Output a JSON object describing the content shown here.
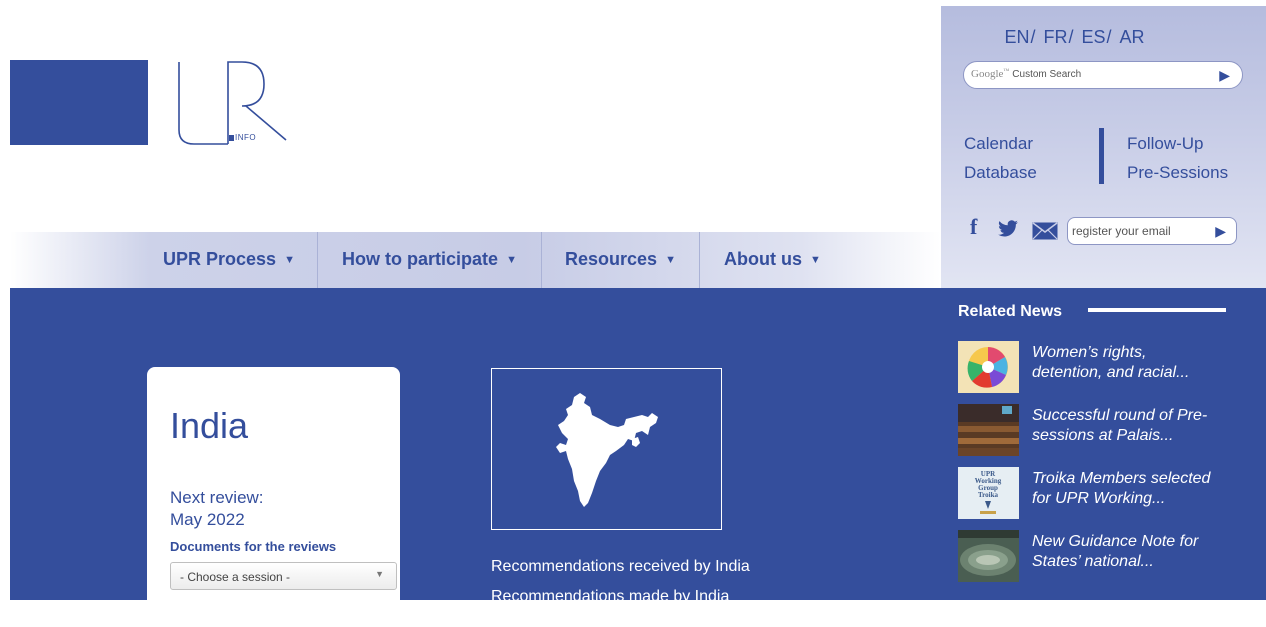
{
  "languages": [
    "EN",
    "FR",
    "ES",
    "AR"
  ],
  "search": {
    "brand": "Google",
    "tm": "™",
    "label": "Custom Search"
  },
  "quick_links": {
    "calendar": "Calendar",
    "database": "Database",
    "follow_up": "Follow-Up",
    "pre_sessions": "Pre-Sessions"
  },
  "newsletter": {
    "placeholder": "register your email"
  },
  "logo": {
    "info": "INFO"
  },
  "nav": [
    {
      "label": "UPR Process"
    },
    {
      "label": "How to participate"
    },
    {
      "label": "Resources"
    },
    {
      "label": "About us"
    }
  ],
  "country_card": {
    "country": "India",
    "next_review_label": "Next review:",
    "next_review_date": "May 2022",
    "documents_title": "Documents for the reviews",
    "session_select": "- Choose a session -"
  },
  "recommendations": {
    "received": "Recommendations received by India",
    "made": "Recommendations made by India"
  },
  "related_news": {
    "title": "Related News",
    "items": [
      {
        "line1": "Women’s rights,",
        "line2": "detention, and racial..."
      },
      {
        "line1": "Successful round of Pre-",
        "line2": "sessions at Palais..."
      },
      {
        "line1": "Troika Members selected",
        "line2": "for UPR Working...",
        "thumb_text": [
          "UPR",
          "Working",
          "Group",
          "Troika"
        ]
      },
      {
        "line1": "New Guidance Note for",
        "line2": "States’ national..."
      }
    ]
  },
  "colors": {
    "brand_blue": "#344e9c",
    "panel": "#c8cde7",
    "white": "#ffffff"
  }
}
